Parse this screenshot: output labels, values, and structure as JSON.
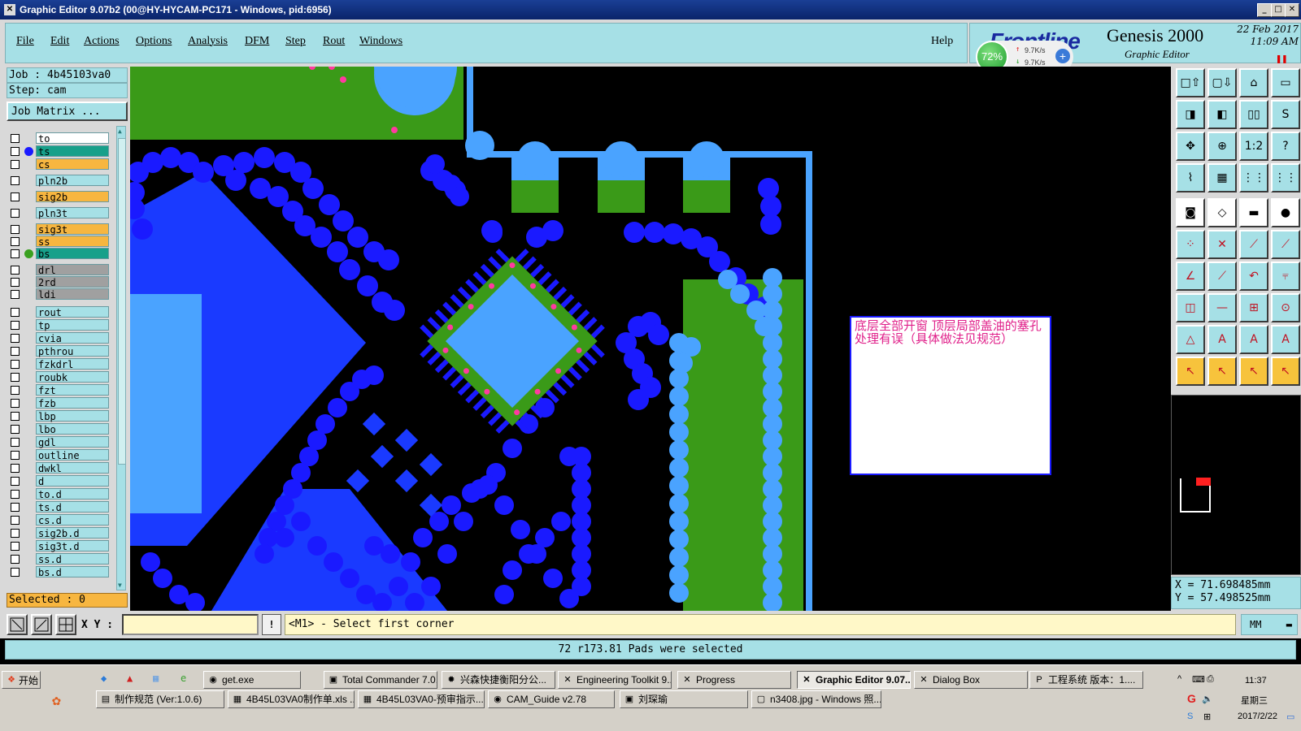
{
  "window": {
    "title": "Graphic Editor 9.07b2 (00@HY-HYCAM-PC171 - Windows, pid:6956)"
  },
  "menu": {
    "items": [
      "File",
      "Edit",
      "Actions",
      "Options",
      "Analysis",
      "DFM",
      "Step",
      "Rout",
      "Windows"
    ],
    "help": "Help"
  },
  "brand": {
    "logo": "Frontline",
    "title": "Genesis 2000",
    "subtitle": "Graphic Editor",
    "date": "22 Feb 2017",
    "time": "11:09 AM"
  },
  "network": {
    "percent": "72%",
    "up": "9.7K/s",
    "down": "9.7K/s"
  },
  "job": {
    "job_label": "Job : 4b45103va0",
    "step_label": "Step: cam",
    "matrix_button": "Job Matrix ..."
  },
  "layers": [
    {
      "name": "to",
      "color": "#ffffff",
      "dot": ""
    },
    {
      "name": "ts",
      "color": "#17a08a",
      "dot": "#1a1aff"
    },
    {
      "name": "cs",
      "color": "#f7b640",
      "dot": ""
    },
    {
      "name": "pln2b",
      "color": "#a6e0e6",
      "dot": ""
    },
    {
      "name": "sig2b",
      "color": "#f7b640",
      "dot": ""
    },
    {
      "name": "pln3t",
      "color": "#a6e0e6",
      "dot": ""
    },
    {
      "name": "sig3t",
      "color": "#f7b640",
      "dot": ""
    },
    {
      "name": "ss",
      "color": "#f7b640",
      "dot": ""
    },
    {
      "name": "bs",
      "color": "#17a08a",
      "dot": "#3aa020"
    },
    {
      "name": "drl",
      "color": "#a0a0a0",
      "dot": ""
    },
    {
      "name": "2rd",
      "color": "#a0a0a0",
      "dot": ""
    },
    {
      "name": "ldi",
      "color": "#a0a0a0",
      "dot": ""
    },
    {
      "name": "rout",
      "color": "#a6e0e6",
      "dot": ""
    },
    {
      "name": "tp",
      "color": "#a6e0e6",
      "dot": ""
    },
    {
      "name": "cvia",
      "color": "#a6e0e6",
      "dot": ""
    },
    {
      "name": "pthrou",
      "color": "#a6e0e6",
      "dot": ""
    },
    {
      "name": "fzkdrl",
      "color": "#a6e0e6",
      "dot": ""
    },
    {
      "name": "roubk",
      "color": "#a6e0e6",
      "dot": ""
    },
    {
      "name": "fzt",
      "color": "#a6e0e6",
      "dot": ""
    },
    {
      "name": "fzb",
      "color": "#a6e0e6",
      "dot": ""
    },
    {
      "name": "lbp",
      "color": "#a6e0e6",
      "dot": ""
    },
    {
      "name": "lbo",
      "color": "#a6e0e6",
      "dot": ""
    },
    {
      "name": "gdl",
      "color": "#a6e0e6",
      "dot": ""
    },
    {
      "name": "outline",
      "color": "#a6e0e6",
      "dot": ""
    },
    {
      "name": "dwkl",
      "color": "#a6e0e6",
      "dot": ""
    },
    {
      "name": "d",
      "color": "#a6e0e6",
      "dot": ""
    },
    {
      "name": "to.d",
      "color": "#a6e0e6",
      "dot": ""
    },
    {
      "name": "ts.d",
      "color": "#a6e0e6",
      "dot": ""
    },
    {
      "name": "cs.d",
      "color": "#a6e0e6",
      "dot": ""
    },
    {
      "name": "sig2b.d",
      "color": "#a6e0e6",
      "dot": ""
    },
    {
      "name": "sig3t.d",
      "color": "#a6e0e6",
      "dot": ""
    },
    {
      "name": "ss.d",
      "color": "#a6e0e6",
      "dot": ""
    },
    {
      "name": "bs.d",
      "color": "#a6e0e6",
      "dot": ""
    }
  ],
  "selected": "Selected : 0",
  "annotation": "底层全部开窗  顶层局部盖油的塞孔处理有误（具体做法见规范）",
  "coords": {
    "x": "X  =  71.698485mm",
    "y": "Y  =  57.498525mm"
  },
  "command": {
    "xy_label": "X Y :",
    "xy_value": "",
    "warn": "!",
    "prompt": "<M1> - Select first corner",
    "units": "MM"
  },
  "status": "72 r173.81 Pads were selected",
  "taskbar": {
    "start": "开始",
    "row1": [
      "get.exe",
      "Total Commander 7.0...",
      "兴森快捷衡阳分公...",
      "Engineering Toolkit 9....",
      "Progress",
      "Graphic Editor 9.07...",
      "Dialog Box",
      "工程系统  版本：1...."
    ],
    "row2": [
      "制作规范 (Ver:1.0.6)",
      "4B45L03VA0制作单.xls ...",
      "4B45L03VA0-预审指示....",
      "CAM_Guide v2.78",
      "刘琛瑜",
      "n3408.jpg - Windows 照..."
    ],
    "clock": "11:37",
    "weekday": "星期三",
    "date": "2017/2/22"
  },
  "colors": {
    "accent": "#a6e0e6",
    "copper": "#1a1aff",
    "mask": "#4aa3ff",
    "green": "#3a9a18",
    "annotation": "#e0208a"
  }
}
